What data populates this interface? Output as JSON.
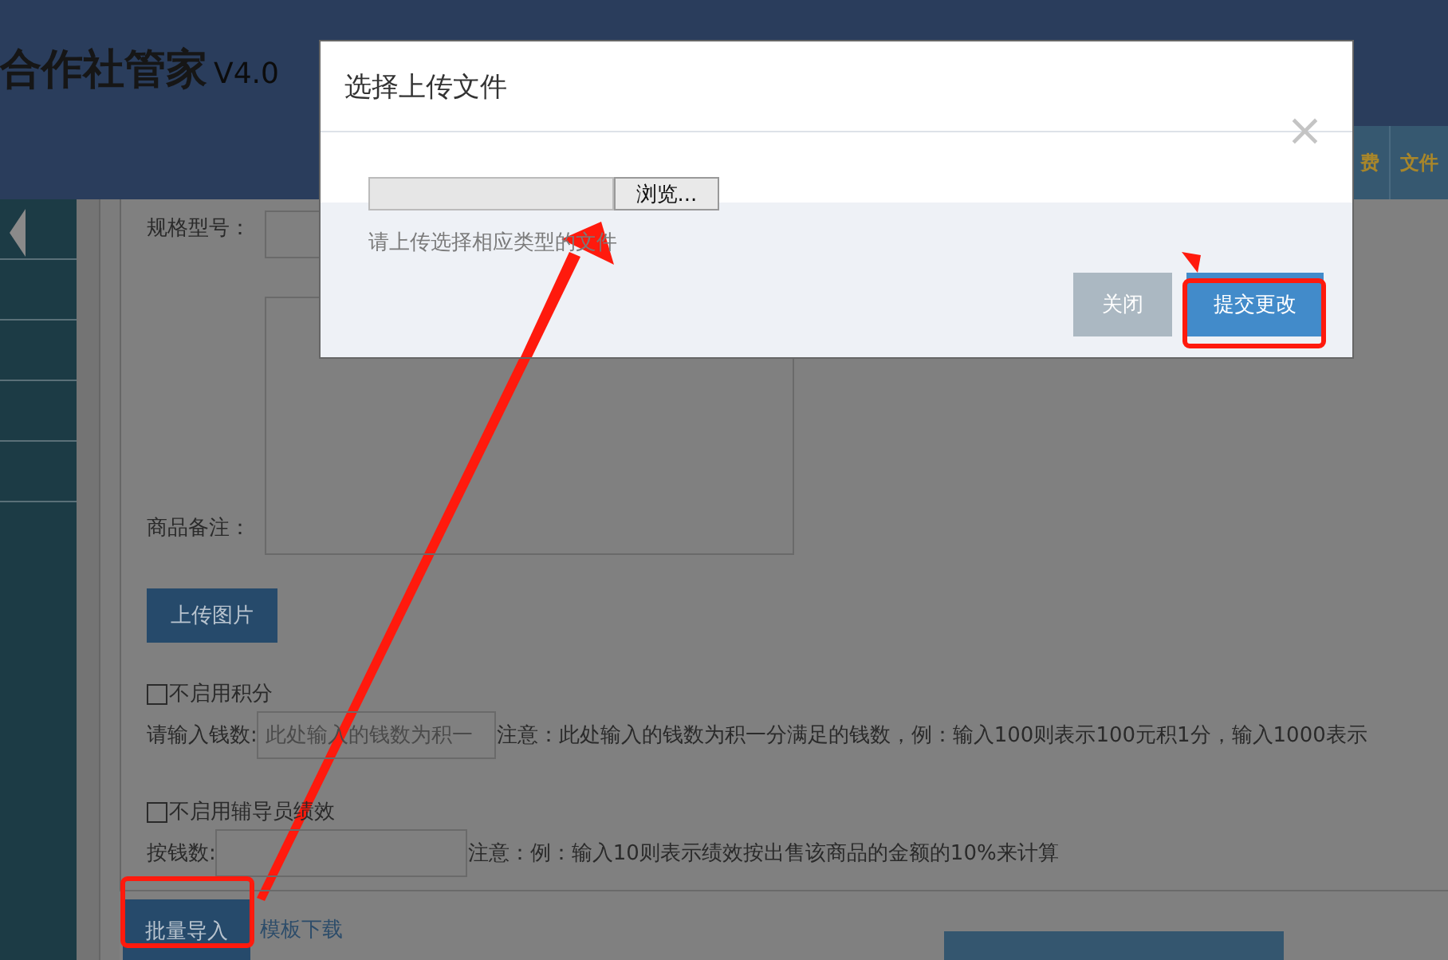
{
  "header": {
    "title": "合作社管家",
    "version": "V4.0",
    "nav_tabs": [
      "费",
      "文件"
    ]
  },
  "form": {
    "spec_label": "规格型号：",
    "remark_label": "商品备注：",
    "upload_button": "上传图片",
    "points": {
      "checkbox_label": "不启用积分",
      "checked": false,
      "input_label": "请输入钱数:",
      "placeholder": "此处输入的钱数为积一",
      "note": "注意：此处输入的钱数为积一分满足的钱数，例：输入100则表示100元积1分，输入1000表示"
    },
    "tutor": {
      "checkbox_label": "不启用辅导员绩效",
      "checked": false,
      "input_label": "按钱数:",
      "note": "注意：例：输入10则表示绩效按出售该商品的金额的10%来计算"
    }
  },
  "footer": {
    "import_button": "批量导入",
    "template_link": "模板下载"
  },
  "modal": {
    "title": "选择上传文件",
    "close": "×",
    "browse_button": "浏览...",
    "hint": "请上传选择相应类型的文件",
    "buttons": [
      {
        "label": "关闭",
        "kind": "secondary"
      },
      {
        "label": "提交更改",
        "kind": "primary"
      }
    ]
  }
}
